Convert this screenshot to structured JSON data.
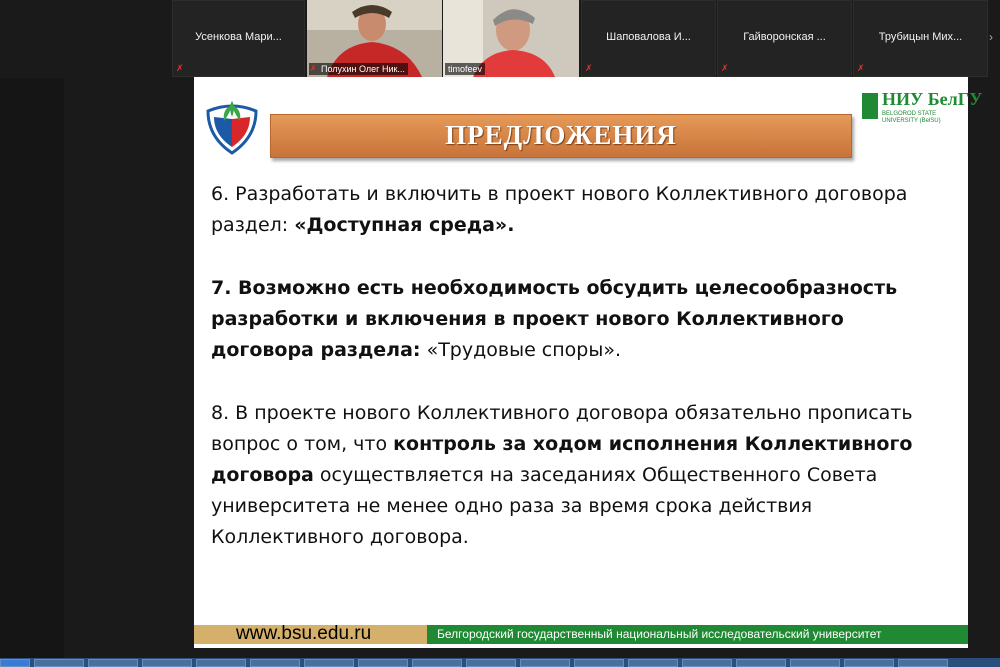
{
  "participants": [
    {
      "name": "Усенкова Мари...",
      "muted": true
    },
    {
      "name": "Полухин Олег Ник...",
      "muted": true,
      "video": true
    },
    {
      "name": "timofeev",
      "muted": false,
      "video": true
    },
    {
      "name": "Шаповалова И...",
      "muted": true
    },
    {
      "name": "Гайворонская ...",
      "muted": true
    },
    {
      "name": "Трубицын Мих...",
      "muted": true
    }
  ],
  "slide": {
    "title": "ПРЕДЛОЖЕНИЯ",
    "logo_right_text": "НИУ БелГУ",
    "logo_right_sub": "BELGOROD STATE UNIVERSITY (BelSU)",
    "items": [
      {
        "pre": "6. Разработать и включить в проект нового Коллективного договора раздел: ",
        "bold": "«Доступная среда».",
        "post": ""
      },
      {
        "pre": "",
        "bold": "7. Возможно есть необходимость обсудить целесообразность разработки и включения в проект нового Коллективного договора раздела:",
        "post": " «Трудовые споры»."
      },
      {
        "pre": "8. В проекте нового Коллективного договора обязательно прописать вопрос о том, что ",
        "bold": "контроль за ходом исполнения Коллективного договора",
        "post": " осуществляется на заседаниях Общественного Совета университета не менее одно раза за время срока действия Коллективного договора."
      }
    ],
    "footer_url": "www.bsu.edu.ru",
    "footer_university": "Белгородский государственный национальный исследовательский университет"
  },
  "colors": {
    "banner": "#d9884a",
    "footer_gold": "#d5b06a",
    "footer_green": "#1f8a33",
    "mute_red": "#e0322f"
  }
}
